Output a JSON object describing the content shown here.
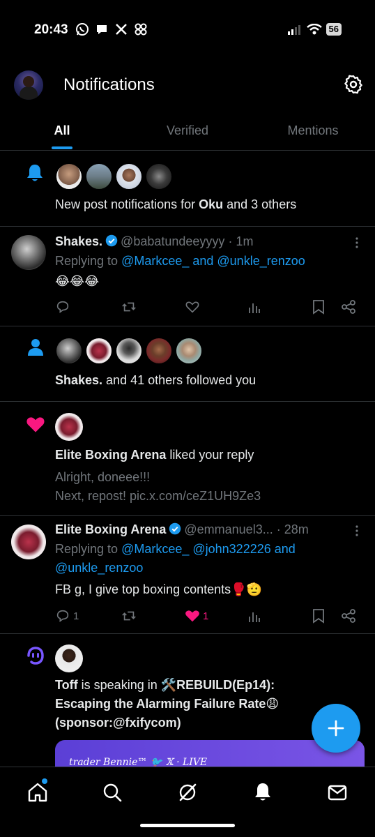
{
  "status_bar": {
    "time": "20:43",
    "battery": "56"
  },
  "header": {
    "title": "Notifications"
  },
  "tabs": [
    {
      "label": "All"
    },
    {
      "label": "Verified"
    },
    {
      "label": "Mentions"
    }
  ],
  "notifications": {
    "n1": {
      "text_pre": "New post notifications for ",
      "name": "Oku",
      "text_post": " and 3 others"
    },
    "n2": {
      "name": "Shakes.",
      "handle": "@babatundeeyyyy",
      "time": "· 1m",
      "replying_label": "Replying to ",
      "replying_to": "@Markcee_ and @unkle_renzoo",
      "body": "😂😂😂"
    },
    "n3": {
      "name": "Shakes.",
      "text": " and 41 others followed you"
    },
    "n4": {
      "name": "Elite Boxing Arena",
      "text": " liked your reply",
      "quote_line1": "Alright, doneee!!!",
      "quote_line2": "Next, repost! pic.x.com/ceZ1UH9Ze3"
    },
    "n5": {
      "name": "Elite Boxing Arena",
      "handle": "@emmanuel3...",
      "time": "· 28m",
      "replying_label": "Replying to ",
      "replying_to_1": "@Markcee_ @john322226 and",
      "replying_to_2": "@unkle_renzoo",
      "body": "FB g, I give top boxing contents🥊🫡",
      "reply_count": "1",
      "like_count": "1"
    },
    "n6": {
      "name": "Toff",
      "text": " is speaking in ",
      "title_line1": "🛠️REBUILD(Ep14):",
      "title_line2": "Escaping the Alarming Failure Rate😩",
      "title_line3": "(sponsor:@fxifycom)",
      "card_text": "trader Bennie™ 🐦 𝕏 · LIVE"
    }
  },
  "colors": {
    "accent": "#1d9bf0",
    "like": "#f91880",
    "spaces": "#7856ff",
    "bg": "#000000"
  }
}
